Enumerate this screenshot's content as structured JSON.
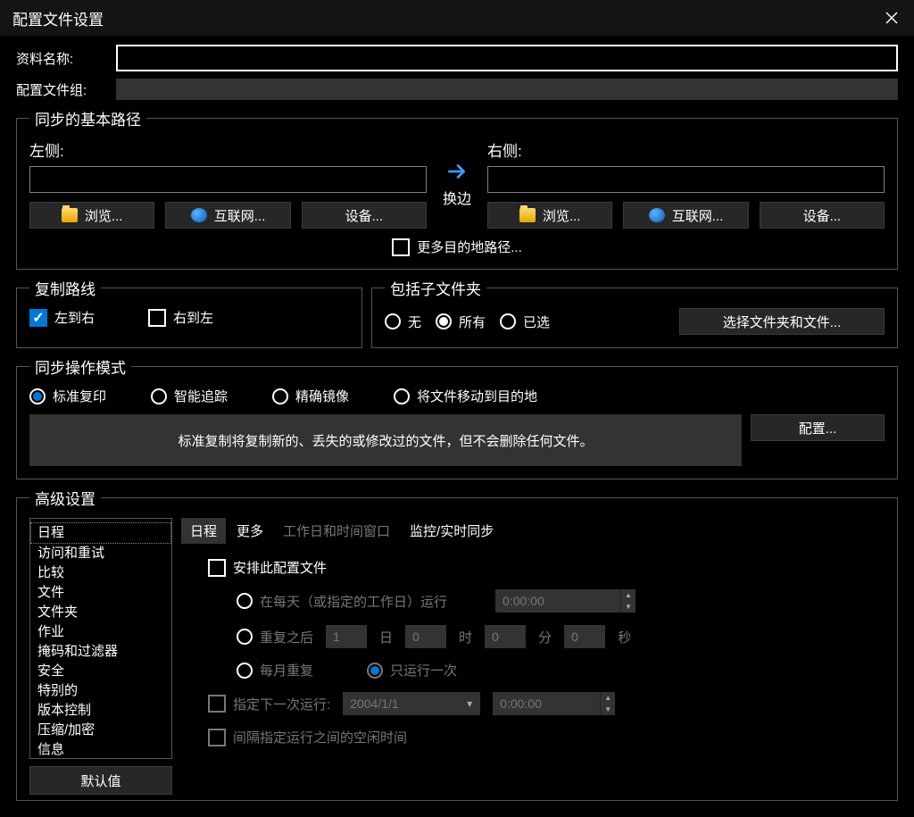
{
  "window": {
    "title": "配置文件设置"
  },
  "profile": {
    "name_label": "资料名称:",
    "name_value": "",
    "group_label": "配置文件组:",
    "group_value": ""
  },
  "basepaths": {
    "legend": "同步的基本路径",
    "left_label": "左侧:",
    "right_label": "右侧:",
    "left_value": "",
    "right_value": "",
    "swap_label": "换边",
    "browse_btn": "浏览...",
    "internet_btn": "互联网...",
    "device_btn": "设备...",
    "more_dest_label": "更多目的地路径..."
  },
  "copydir": {
    "legend": "复制路线",
    "ltr": "左到右",
    "rtl": "右到左"
  },
  "subfolders": {
    "legend": "包括子文件夹",
    "none": "无",
    "all": "所有",
    "selected": "已选",
    "select_btn": "选择文件夹和文件..."
  },
  "mode": {
    "legend": "同步操作模式",
    "standard": "标准复印",
    "smart": "智能追踪",
    "mirror": "精确镜像",
    "move": "将文件移动到目的地",
    "desc": "标准复制将复制新的、丢失的或修改过的文件，但不会删除任何文件。",
    "config_btn": "配置..."
  },
  "advanced": {
    "legend": "高级设置",
    "items": [
      "日程",
      "访问和重试",
      "比较",
      "文件",
      "文件夹",
      "作业",
      "掩码和过滤器",
      "安全",
      "特别的",
      "版本控制",
      "压缩/加密",
      "信息"
    ],
    "default_btn": "默认值",
    "tabs": {
      "schedule": "日程",
      "more": "更多",
      "workday": "工作日和时间窗口",
      "monitor": "监控/实时同步"
    },
    "schedule": {
      "enable": "安排此配置文件",
      "daily": "在每天（或指定的工作日）运行",
      "daily_time": "0:00:00",
      "repeat_after": "重复之后",
      "days_val": "1",
      "days_unit": "日",
      "hours_val": "0",
      "hours_unit": "时",
      "mins_val": "0",
      "mins_unit": "分",
      "secs_val": "0",
      "secs_unit": "秒",
      "monthly": "每月重复",
      "once": "只运行一次",
      "next_run": "指定下一次运行:",
      "next_date": "2004/1/1",
      "next_time": "0:00:00",
      "idle_between": "间隔指定运行之间的空闲时间"
    }
  }
}
